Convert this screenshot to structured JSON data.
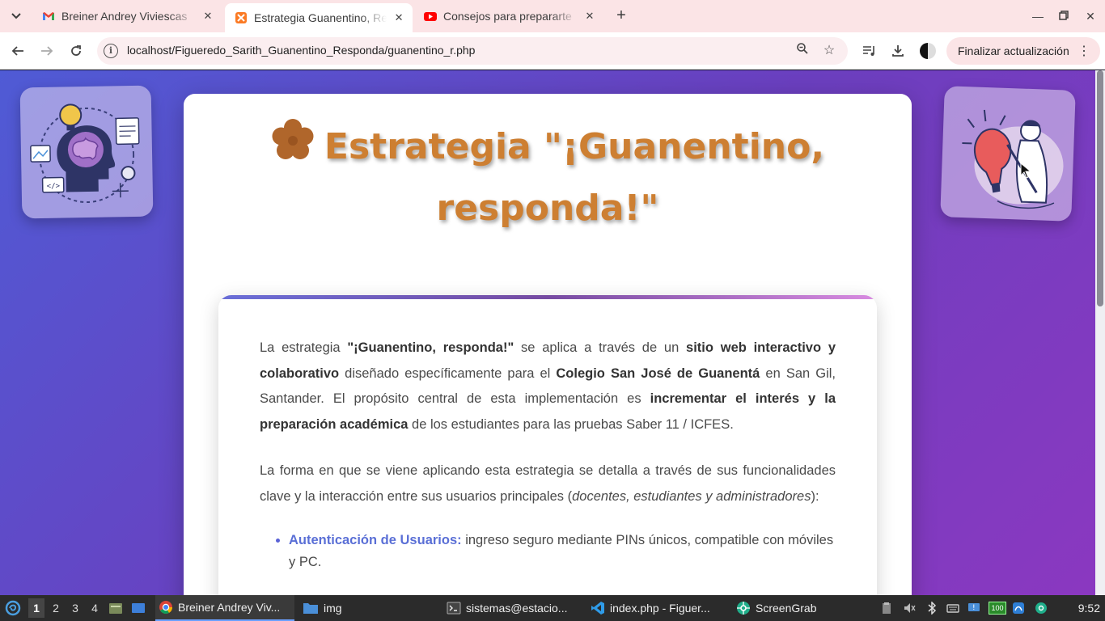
{
  "tabs": [
    {
      "title": "Breiner Andrey Viviescas",
      "favicon": "gmail-icon"
    },
    {
      "title": "Estrategia Guanentino, Responda",
      "favicon": "xampp-icon",
      "active": true
    },
    {
      "title": "Consejos para prepararte",
      "favicon": "youtube-icon"
    }
  ],
  "toolbar": {
    "url": "localhost/Figueredo_Sarith_Guanentino_Responda/guanentino_r.php",
    "update_label": "Finalizar actualización"
  },
  "page": {
    "headline_line1": "Estrategia \"¡Guanentino,",
    "headline_line2": "responda!\"",
    "p1": {
      "a": "La estrategia ",
      "b": "\"¡Guanentino, responda!\"",
      "c": " se aplica a través de un ",
      "d": "sitio web interactivo y colaborativo",
      "e": " diseñado específicamente para el ",
      "f": "Colegio San José de Guanentá",
      "g": " en San Gil, Santander. El propósito central de esta implementación es ",
      "h": "incrementar el interés y la preparación académica",
      "i": " de los estudiantes para las pruebas Saber 11 / ICFES."
    },
    "p2": {
      "a": "La forma en que se viene aplicando esta estrategia se detalla a través de sus funcionalidades clave y la interacción entre sus usuarios principales (",
      "b": "docentes, estudiantes y administradores",
      "c": "):"
    },
    "list": [
      {
        "head": "Autenticación de Usuarios:",
        "text": " ingreso seguro mediante PINs únicos, compatible con móviles y PC."
      }
    ]
  },
  "taskbar": {
    "workspaces": [
      "1",
      "2",
      "3",
      "4"
    ],
    "items": [
      {
        "label": "Breiner Andrey Viv...",
        "icon": "chrome-icon"
      },
      {
        "label": "img",
        "icon": "folder-icon"
      },
      {
        "label": "sistemas@estacio...",
        "icon": "terminal-icon"
      },
      {
        "label": "index.php - Figuer...",
        "icon": "vscode-icon"
      },
      {
        "label": "ScreenGrab",
        "icon": "screengrab-icon"
      }
    ],
    "battery": "100",
    "clock": "9:52"
  }
}
